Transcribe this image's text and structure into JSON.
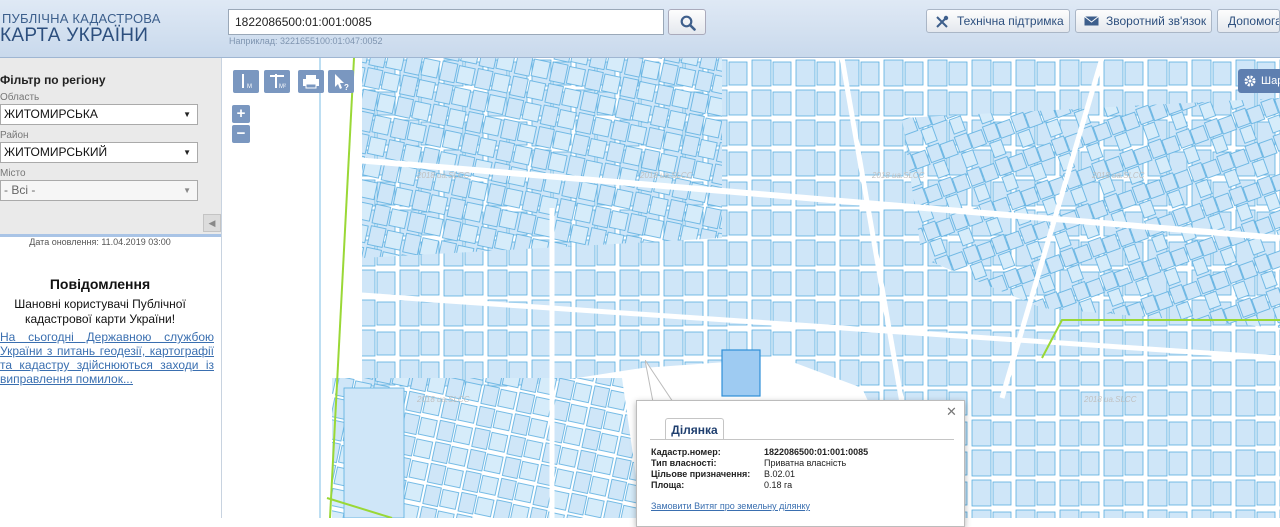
{
  "logo": {
    "line1": "ПУБЛІЧНА КАДАСТРОВА",
    "line2": "КАРТА УКРАЇНИ"
  },
  "search": {
    "value": "1822086500:01:001:0085",
    "hint": "Наприклад: 3221655100:01:047:0052"
  },
  "header_buttons": {
    "support": "Технічна підтримка",
    "feedback": "Зворотний зв'язок",
    "help": "Допомога"
  },
  "filter": {
    "title": "Фільтр по регіону",
    "oblast_label": "Область",
    "oblast_value": "ЖИТОМИРСЬКА",
    "rayon_label": "Район",
    "rayon_value": "ЖИТОМИРСЬКИЙ",
    "misto_label": "Місто",
    "misto_value": "- Всі -"
  },
  "update_date": "Дата оновлення: 11.04.2019 03:00",
  "message": {
    "title": "Повідомлення",
    "text": "Шановні користувачі Публічної кадастрової карти України!",
    "link": "На сьогодні Державною службою України з питань геодезії, картографії та кадастру здійснюються заходи із виправлення помилок..."
  },
  "map": {
    "layers_label": "Шари",
    "watermark": "2018 ua.SLCC",
    "parcel_color": "#cfe6f8",
    "parcel_border": "#5aaee0",
    "boundary_color": "#9ad836"
  },
  "popup": {
    "tab": "Ділянка",
    "rows": [
      {
        "label": "Кадастр.номер:",
        "value": "1822086500:01:001:0085"
      },
      {
        "label": "Тип власності:",
        "value": "Приватна власність"
      },
      {
        "label": "Цільове призначення:",
        "value": "В.02.01"
      },
      {
        "label": "Площа:",
        "value": "0.18 га"
      }
    ],
    "link": "Замовити Витяг про земельну ділянку"
  }
}
